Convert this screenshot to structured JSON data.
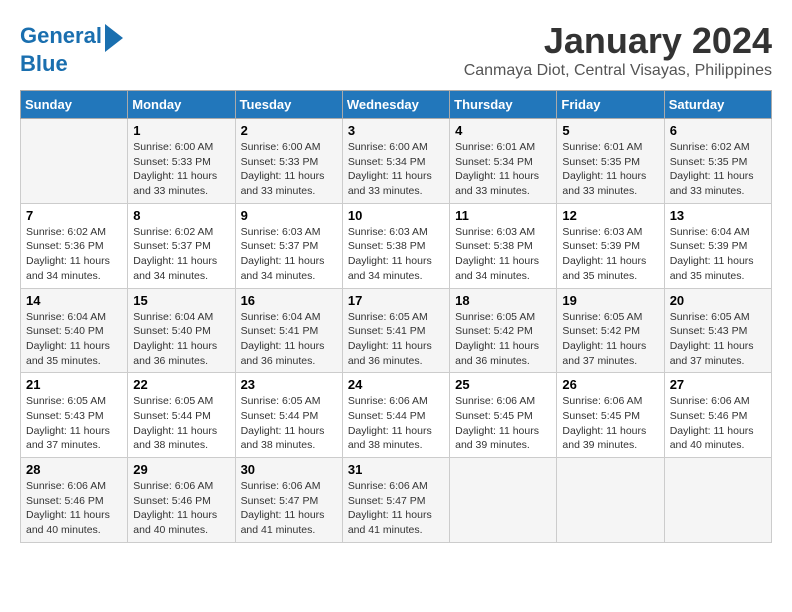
{
  "header": {
    "logo_line1": "General",
    "logo_line2": "Blue",
    "month_title": "January 2024",
    "location": "Canmaya Diot, Central Visayas, Philippines"
  },
  "days_of_week": [
    "Sunday",
    "Monday",
    "Tuesday",
    "Wednesday",
    "Thursday",
    "Friday",
    "Saturday"
  ],
  "weeks": [
    [
      {
        "day": "",
        "info": ""
      },
      {
        "day": "1",
        "info": "Sunrise: 6:00 AM\nSunset: 5:33 PM\nDaylight: 11 hours\nand 33 minutes."
      },
      {
        "day": "2",
        "info": "Sunrise: 6:00 AM\nSunset: 5:33 PM\nDaylight: 11 hours\nand 33 minutes."
      },
      {
        "day": "3",
        "info": "Sunrise: 6:00 AM\nSunset: 5:34 PM\nDaylight: 11 hours\nand 33 minutes."
      },
      {
        "day": "4",
        "info": "Sunrise: 6:01 AM\nSunset: 5:34 PM\nDaylight: 11 hours\nand 33 minutes."
      },
      {
        "day": "5",
        "info": "Sunrise: 6:01 AM\nSunset: 5:35 PM\nDaylight: 11 hours\nand 33 minutes."
      },
      {
        "day": "6",
        "info": "Sunrise: 6:02 AM\nSunset: 5:35 PM\nDaylight: 11 hours\nand 33 minutes."
      }
    ],
    [
      {
        "day": "7",
        "info": "Sunrise: 6:02 AM\nSunset: 5:36 PM\nDaylight: 11 hours\nand 34 minutes."
      },
      {
        "day": "8",
        "info": "Sunrise: 6:02 AM\nSunset: 5:37 PM\nDaylight: 11 hours\nand 34 minutes."
      },
      {
        "day": "9",
        "info": "Sunrise: 6:03 AM\nSunset: 5:37 PM\nDaylight: 11 hours\nand 34 minutes."
      },
      {
        "day": "10",
        "info": "Sunrise: 6:03 AM\nSunset: 5:38 PM\nDaylight: 11 hours\nand 34 minutes."
      },
      {
        "day": "11",
        "info": "Sunrise: 6:03 AM\nSunset: 5:38 PM\nDaylight: 11 hours\nand 34 minutes."
      },
      {
        "day": "12",
        "info": "Sunrise: 6:03 AM\nSunset: 5:39 PM\nDaylight: 11 hours\nand 35 minutes."
      },
      {
        "day": "13",
        "info": "Sunrise: 6:04 AM\nSunset: 5:39 PM\nDaylight: 11 hours\nand 35 minutes."
      }
    ],
    [
      {
        "day": "14",
        "info": "Sunrise: 6:04 AM\nSunset: 5:40 PM\nDaylight: 11 hours\nand 35 minutes."
      },
      {
        "day": "15",
        "info": "Sunrise: 6:04 AM\nSunset: 5:40 PM\nDaylight: 11 hours\nand 36 minutes."
      },
      {
        "day": "16",
        "info": "Sunrise: 6:04 AM\nSunset: 5:41 PM\nDaylight: 11 hours\nand 36 minutes."
      },
      {
        "day": "17",
        "info": "Sunrise: 6:05 AM\nSunset: 5:41 PM\nDaylight: 11 hours\nand 36 minutes."
      },
      {
        "day": "18",
        "info": "Sunrise: 6:05 AM\nSunset: 5:42 PM\nDaylight: 11 hours\nand 36 minutes."
      },
      {
        "day": "19",
        "info": "Sunrise: 6:05 AM\nSunset: 5:42 PM\nDaylight: 11 hours\nand 37 minutes."
      },
      {
        "day": "20",
        "info": "Sunrise: 6:05 AM\nSunset: 5:43 PM\nDaylight: 11 hours\nand 37 minutes."
      }
    ],
    [
      {
        "day": "21",
        "info": "Sunrise: 6:05 AM\nSunset: 5:43 PM\nDaylight: 11 hours\nand 37 minutes."
      },
      {
        "day": "22",
        "info": "Sunrise: 6:05 AM\nSunset: 5:44 PM\nDaylight: 11 hours\nand 38 minutes."
      },
      {
        "day": "23",
        "info": "Sunrise: 6:05 AM\nSunset: 5:44 PM\nDaylight: 11 hours\nand 38 minutes."
      },
      {
        "day": "24",
        "info": "Sunrise: 6:06 AM\nSunset: 5:44 PM\nDaylight: 11 hours\nand 38 minutes."
      },
      {
        "day": "25",
        "info": "Sunrise: 6:06 AM\nSunset: 5:45 PM\nDaylight: 11 hours\nand 39 minutes."
      },
      {
        "day": "26",
        "info": "Sunrise: 6:06 AM\nSunset: 5:45 PM\nDaylight: 11 hours\nand 39 minutes."
      },
      {
        "day": "27",
        "info": "Sunrise: 6:06 AM\nSunset: 5:46 PM\nDaylight: 11 hours\nand 40 minutes."
      }
    ],
    [
      {
        "day": "28",
        "info": "Sunrise: 6:06 AM\nSunset: 5:46 PM\nDaylight: 11 hours\nand 40 minutes."
      },
      {
        "day": "29",
        "info": "Sunrise: 6:06 AM\nSunset: 5:46 PM\nDaylight: 11 hours\nand 40 minutes."
      },
      {
        "day": "30",
        "info": "Sunrise: 6:06 AM\nSunset: 5:47 PM\nDaylight: 11 hours\nand 41 minutes."
      },
      {
        "day": "31",
        "info": "Sunrise: 6:06 AM\nSunset: 5:47 PM\nDaylight: 11 hours\nand 41 minutes."
      },
      {
        "day": "",
        "info": ""
      },
      {
        "day": "",
        "info": ""
      },
      {
        "day": "",
        "info": ""
      }
    ]
  ]
}
